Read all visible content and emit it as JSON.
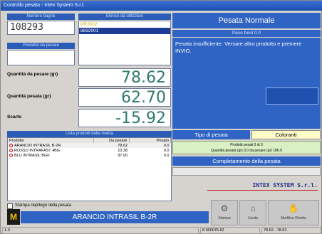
{
  "window": {
    "title": "Controllo pesata - Intex System S.r.l."
  },
  "left": {
    "numero_bagno_label": "Numero bagno",
    "numero_bagno_value": "108293",
    "prodotto_label": "Prodotto da pesare",
    "elenco_label": "Elenco da utilizzare",
    "elenco_items": [
      "PR3002",
      "8832001"
    ],
    "quantita_da_pesare_label": "Quantità da pesare (gr)",
    "quantita_da_pesare_value": "78.62",
    "quantita_pesata_label": "Quantità pesata (gr)",
    "quantita_pesata_value": "62.70",
    "scarto_label": "Scarto",
    "scarto_value": "-15.92"
  },
  "list": {
    "title": "Lista prodotti della ricetta",
    "columns": [
      "Prodotto",
      "Da pesare",
      "Pesato"
    ],
    "rows": [
      {
        "prodotto": "ARANCIO INTRASIL B-2R",
        "da_pesare": "78.62",
        "pesato": "0.0"
      },
      {
        "prodotto": "ROSSO INTRAFAST 4BG",
        "da_pesare": "10.38",
        "pesato": "0.0"
      },
      {
        "prodotto": "BLU INTRASIL BGF",
        "da_pesare": "97.00",
        "pesato": "0.0"
      }
    ],
    "checkbox_label": "Stampa riepilogo della pesata"
  },
  "right": {
    "pesata_title": "Pesata Normale",
    "peso_fuori": "Peso fuori 0.0",
    "message": "Pesata insufficiente. Versare altro prodotto e premere INVIO.",
    "tipo_label": "Tipo di pesata",
    "tipo_value": "Coloranti",
    "info_line1": "Prodotti pesati 0 di 3",
    "info_line2": "Quantità pesata (gr) 0.0 da pesare (gr) 186.9",
    "completamento_label": "Completamento della pesata",
    "brand": "INTEX SYSTEM S.r.l."
  },
  "bottom": {
    "current_product": "ARANCIO INTRASIL B-2R",
    "btn1": "Stampa",
    "btn2": "Uscita",
    "btn3": "Modifica Ricetta"
  },
  "statusbar": {
    "left": "1-3",
    "mid": "8 300075.62",
    "right": "78.62 - 78.62"
  },
  "colors": {
    "accent": "#2f64c4",
    "number": "#2f7a6e",
    "brand": "#1a2e8c"
  }
}
